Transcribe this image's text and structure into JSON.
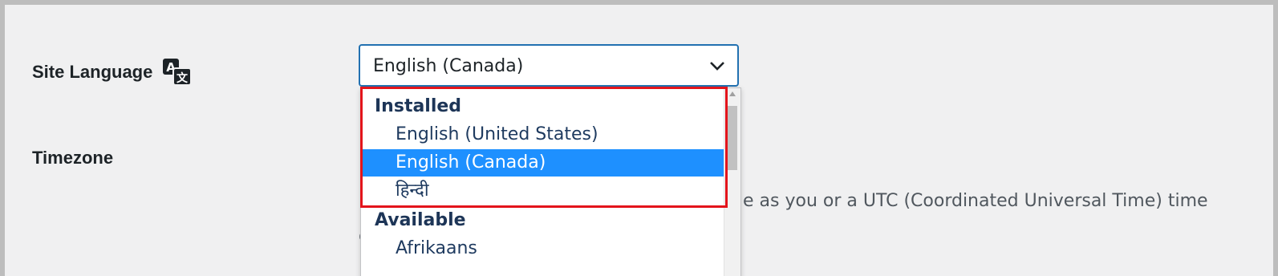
{
  "settings": {
    "site_language_label": "Site Language",
    "timezone_label": "Timezone",
    "timezone_description": "e as you or a UTC (Coordinated Universal Time) time",
    "timezone_description_cut": "c"
  },
  "language_select": {
    "value": "English (Canada)",
    "options": {
      "group_installed": "Installed",
      "opt_en_us": "English (United States)",
      "opt_en_ca": "English (Canada)",
      "opt_hi": "हिन्दी",
      "group_available": "Available",
      "opt_af": "Afrikaans"
    }
  },
  "colors": {
    "accent": "#2271b1",
    "selected_option": "#1e90ff",
    "highlight_box": "#e3141b"
  }
}
